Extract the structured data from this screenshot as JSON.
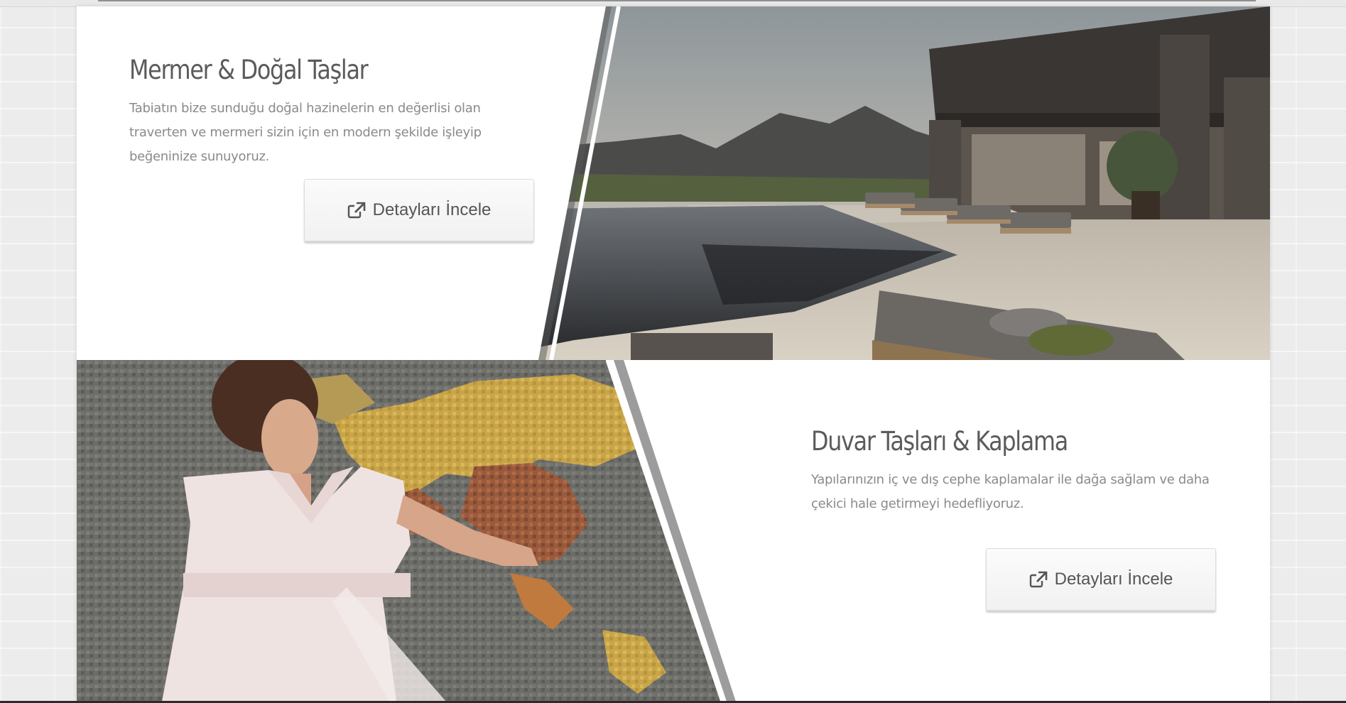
{
  "sections": [
    {
      "title": "Mermer & Doğal Taşlar",
      "description": "Tabiatın bize sunduğu doğal hazinelerin en değerlisi olan traverten ve mermeri sizin için en modern şekilde işleyip beğeninize sunuyoruz.",
      "button_label": "Detayları İncele",
      "button_icon": "external-link-icon",
      "image": "luxury-villa-pool-terrace-photo"
    },
    {
      "title": "Duvar Taşları & Kaplama",
      "description": "Yapılarınızın iç ve dış cephe kaplamalar ile dağa sağlam ve daha çekici hale getirmeyi hedefliyoruz.",
      "button_label": "Detayları İncele",
      "button_icon": "external-link-icon",
      "image": "woman-mosaic-world-map-photo"
    }
  ],
  "colors": {
    "title": "#5b5b5b",
    "text": "#8a8a8a",
    "button_bg": "#f5f5f5",
    "page_bg": "#ececec"
  }
}
